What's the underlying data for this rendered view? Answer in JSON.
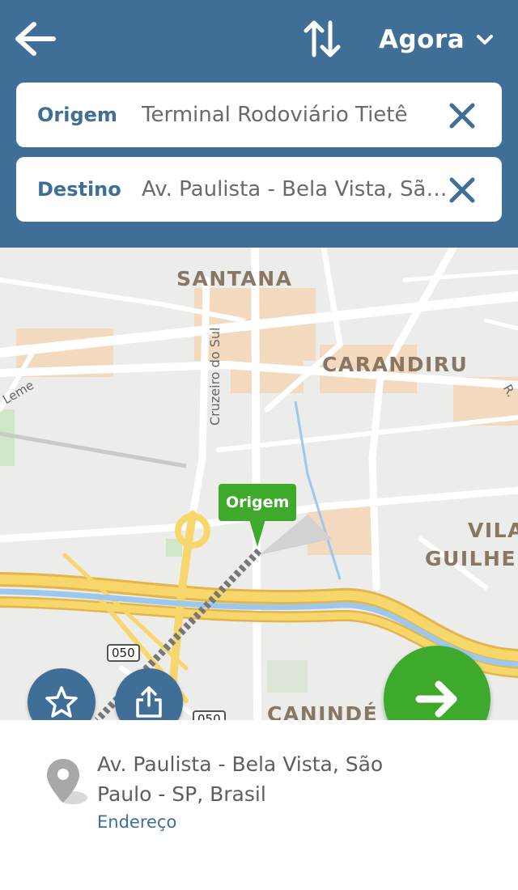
{
  "header": {
    "time_selector": "Agora",
    "origin": {
      "label": "Origem",
      "value": "Terminal Rodoviário Tietê"
    },
    "destination": {
      "label": "Destino",
      "value": "Av. Paulista - Bela Vista, São Paulo - SP, Brasil"
    }
  },
  "map": {
    "labels": [
      "SANTANA",
      "CARANDIRU",
      "VILA",
      "GUILHERME",
      "CANINDÉ"
    ],
    "streets": [
      "Cruzeiro do Sul",
      "Leme",
      "R."
    ],
    "shields": [
      "050",
      "050"
    ],
    "pin_label": "Origem"
  },
  "sheet": {
    "address": "Av. Paulista - Bela Vista, São Paulo - SP, Brasil",
    "address_type": "Endereço"
  },
  "colors": {
    "header": "#3f6f97",
    "primary_green": "#3eaa2c",
    "map_bg": "#ececea",
    "highway": "#f5c94e",
    "river": "#9cc8ec"
  },
  "icons": {
    "back": "arrow-left-icon",
    "swap": "swap-vertical-icon",
    "dropdown": "chevron-down-icon",
    "clear": "close-icon",
    "favorite": "star-icon",
    "share": "share-icon",
    "go": "arrow-right-icon",
    "location": "location-pin-icon"
  }
}
